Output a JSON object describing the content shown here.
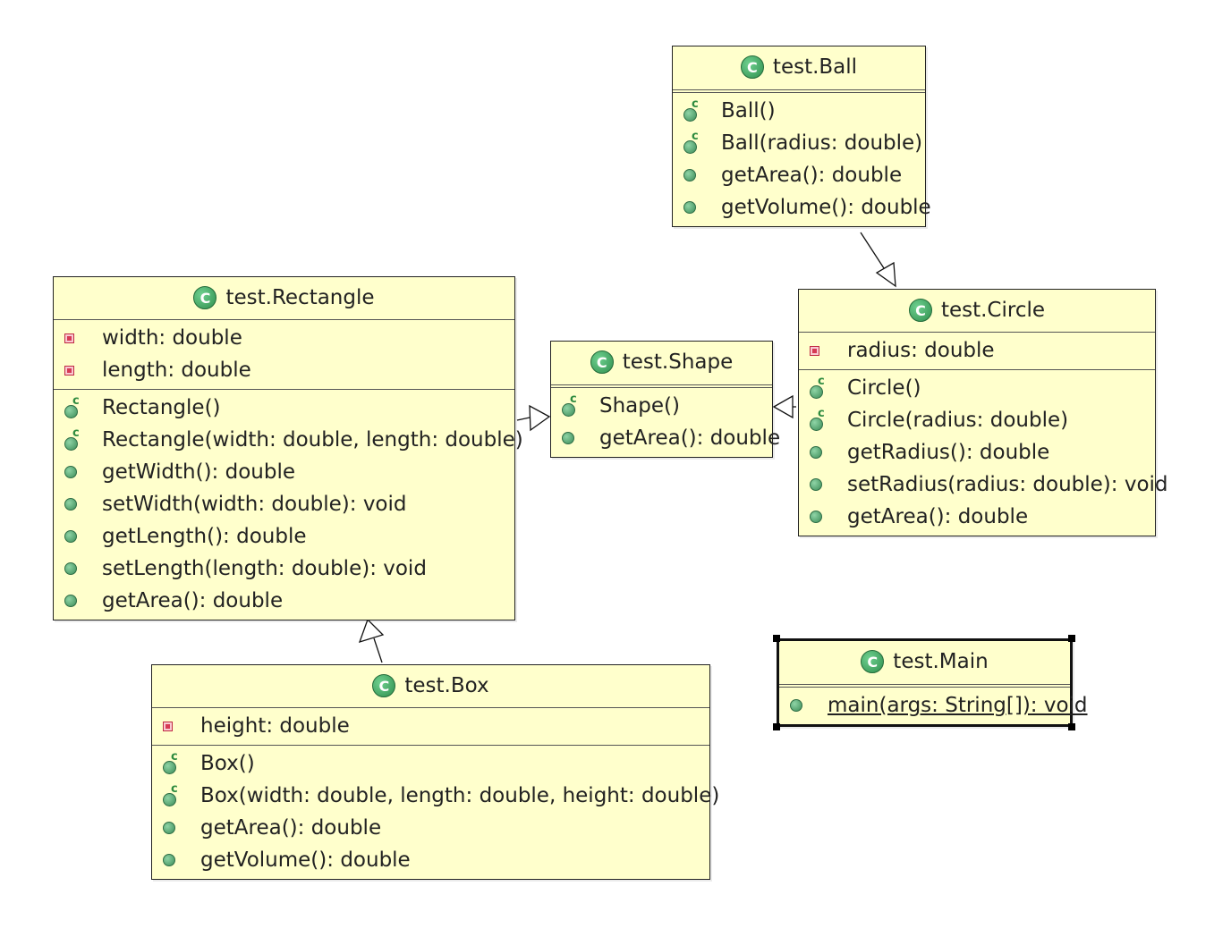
{
  "classes": {
    "ball": {
      "name": "test.Ball",
      "members": [
        "Ball()",
        "Ball(radius: double)",
        "getArea(): double",
        "getVolume(): double"
      ]
    },
    "rectangle": {
      "name": "test.Rectangle",
      "fields": [
        "width: double",
        "length: double"
      ],
      "members": [
        "Rectangle()",
        "Rectangle(width: double, length: double)",
        "getWidth(): double",
        "setWidth(width: double): void",
        "getLength(): double",
        "setLength(length: double): void",
        "getArea(): double"
      ]
    },
    "shape": {
      "name": "test.Shape",
      "members": [
        "Shape()",
        "getArea(): double"
      ]
    },
    "circle": {
      "name": "test.Circle",
      "fields": [
        "radius: double"
      ],
      "members": [
        "Circle()",
        "Circle(radius: double)",
        "getRadius(): double",
        "setRadius(radius: double): void",
        "getArea(): double"
      ]
    },
    "box": {
      "name": "test.Box",
      "fields": [
        "height: double"
      ],
      "members": [
        "Box()",
        "Box(width: double, length: double, height: double)",
        "getArea(): double",
        "getVolume(): double"
      ]
    },
    "main": {
      "name": "test.Main",
      "members": [
        "main(args: String[]): void"
      ]
    }
  },
  "icons": {
    "class": "class-icon",
    "constructor": "constructor-icon",
    "public_method": "public-method-icon",
    "private_field": "private-field-icon"
  },
  "colors": {
    "class_fill": "#ffffcc",
    "icon_green": "#2f8f4e",
    "private_red": "#c02a44"
  }
}
